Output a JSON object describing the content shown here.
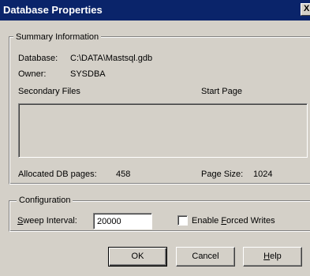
{
  "window": {
    "title": "Database Properties",
    "close_glyph": "X"
  },
  "summary": {
    "legend": "Summary Information",
    "database_label": "Database:",
    "database_value": "C:\\DATA\\Mastsql.gdb",
    "owner_label": "Owner:",
    "owner_value": "SYSDBA",
    "secondary_files_header": "Secondary Files",
    "start_page_header": "Start Page",
    "secondary_files": [],
    "allocated_label": "Allocated DB pages:",
    "allocated_value": "458",
    "page_size_label": "Page Size:",
    "page_size_value": "1024"
  },
  "configuration": {
    "legend": "Configuration",
    "sweep_label_mnemonic": "S",
    "sweep_label_rest": "weep Interval:",
    "sweep_value": "20000",
    "forced_writes_label_pre": "Enable ",
    "forced_writes_label_mnemonic": "F",
    "forced_writes_label_post": "orced Writes",
    "forced_writes_checked": false
  },
  "buttons": {
    "ok": "OK",
    "cancel": "Cancel",
    "help_mnemonic": "H",
    "help_rest": "elp"
  },
  "colors": {
    "titlebar": "#0a246a",
    "face": "#d4d0c8"
  }
}
